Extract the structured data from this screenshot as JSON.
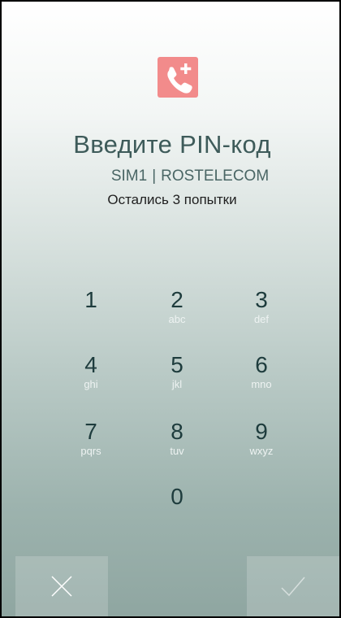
{
  "header": {
    "icon": "sim-call-icon",
    "title": "Введите PIN-код",
    "sim_slot": "SIM1",
    "separator": "|",
    "carrier": "ROSTELECOM",
    "attempts_text": "Остались 3 попытки"
  },
  "keypad": {
    "keys": [
      {
        "digit": "1",
        "letters": ""
      },
      {
        "digit": "2",
        "letters": "abc"
      },
      {
        "digit": "3",
        "letters": "def"
      },
      {
        "digit": "4",
        "letters": "ghi"
      },
      {
        "digit": "5",
        "letters": "jkl"
      },
      {
        "digit": "6",
        "letters": "mno"
      },
      {
        "digit": "7",
        "letters": "pqrs"
      },
      {
        "digit": "8",
        "letters": "tuv"
      },
      {
        "digit": "9",
        "letters": "wxyz"
      },
      {
        "digit": "0",
        "letters": ""
      }
    ]
  },
  "actions": {
    "cancel_icon": "close-icon",
    "confirm_icon": "checkmark-icon"
  },
  "colors": {
    "icon_background": "#f28b8b",
    "title_text": "#3e5b5a",
    "digit_text": "#1e3c3d"
  }
}
